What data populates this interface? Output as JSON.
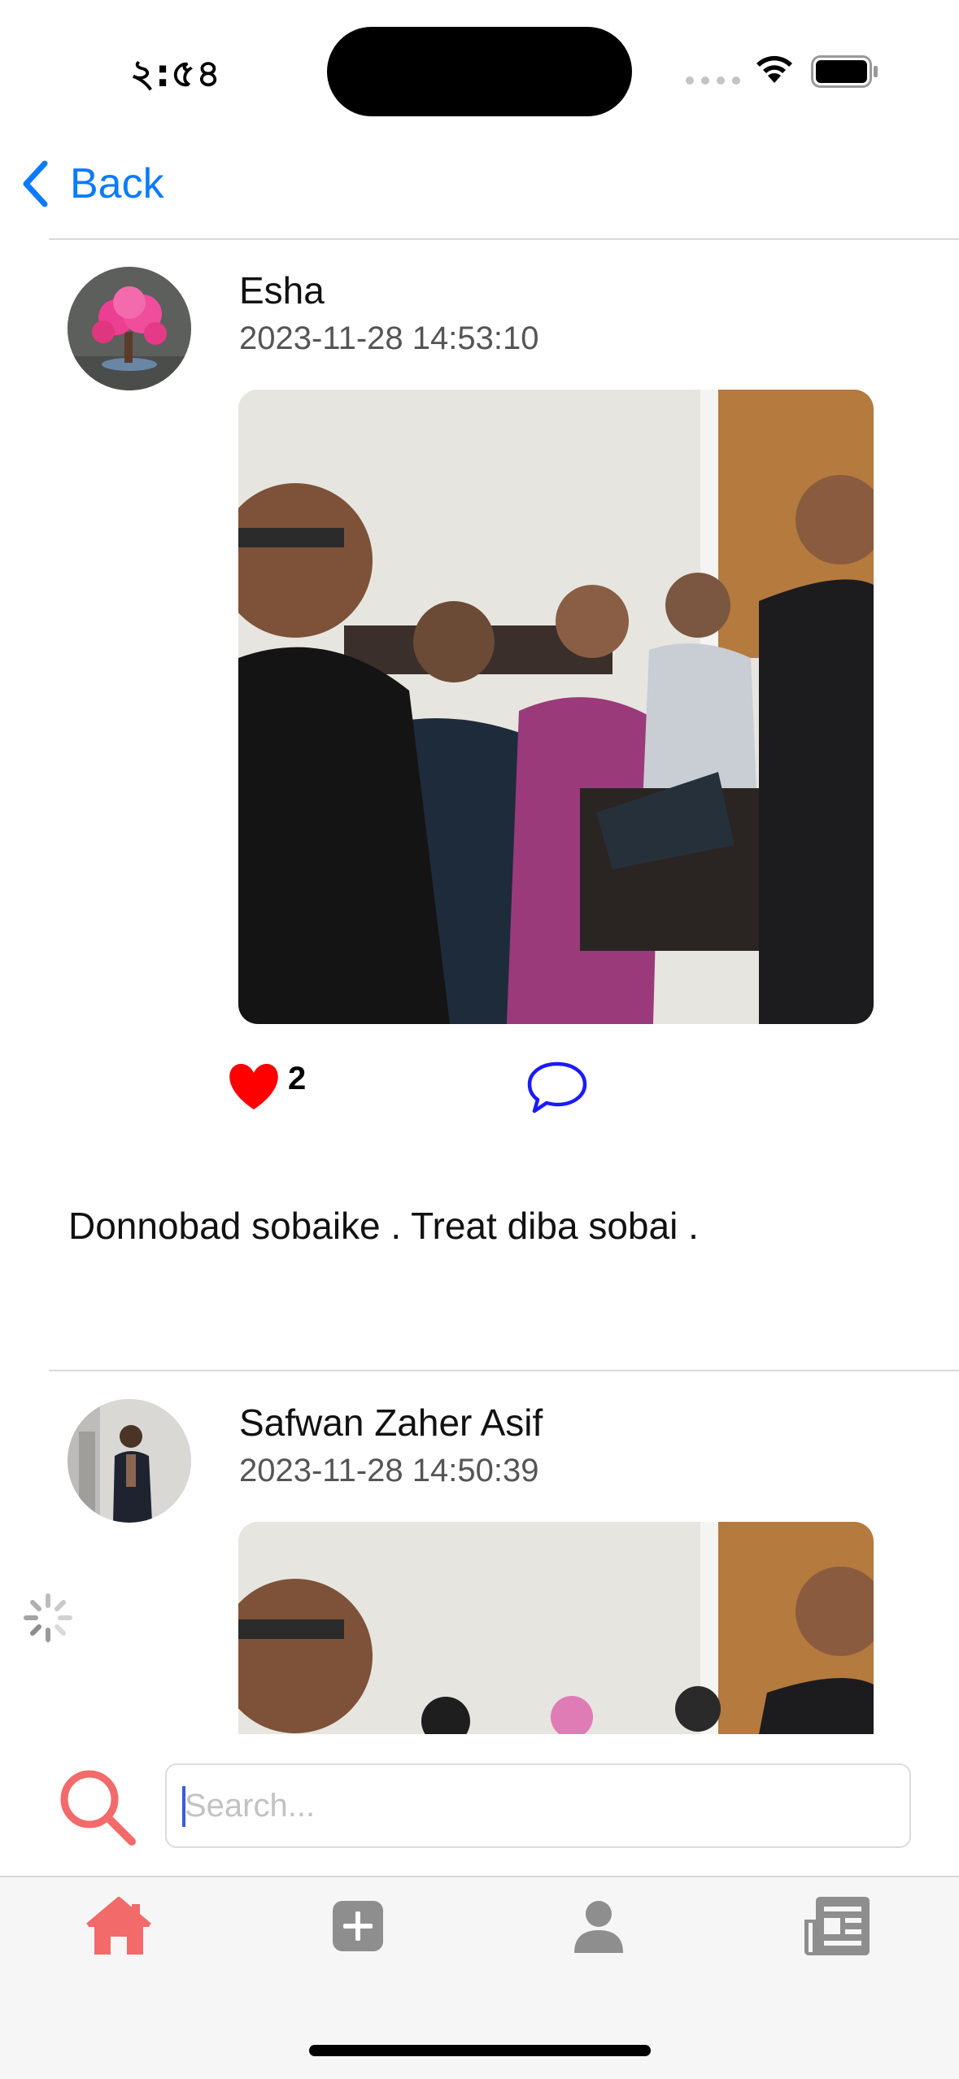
{
  "status_bar": {
    "time": "২:৫৪"
  },
  "nav": {
    "back_label": "Back"
  },
  "posts": [
    {
      "author": "Esha",
      "timestamp": "2023-11-28 14:53:10",
      "likes": "2",
      "text": "Donnobad sobaike . Treat diba sobai  ."
    },
    {
      "author": "Safwan Zaher Asif",
      "timestamp": "2023-11-28 14:50:39"
    }
  ],
  "search": {
    "placeholder": "Search..."
  },
  "tabs": [
    {
      "icon": "home-icon",
      "active": true
    },
    {
      "icon": "add-post-icon",
      "active": false
    },
    {
      "icon": "profile-icon",
      "active": false
    },
    {
      "icon": "news-icon",
      "active": false
    }
  ],
  "colors": {
    "accent": "#0a7bff",
    "like": "#ff0000",
    "comment": "#1a1aff",
    "tab_active": "#f26a6a",
    "tab_inactive": "#8e8e8e"
  }
}
